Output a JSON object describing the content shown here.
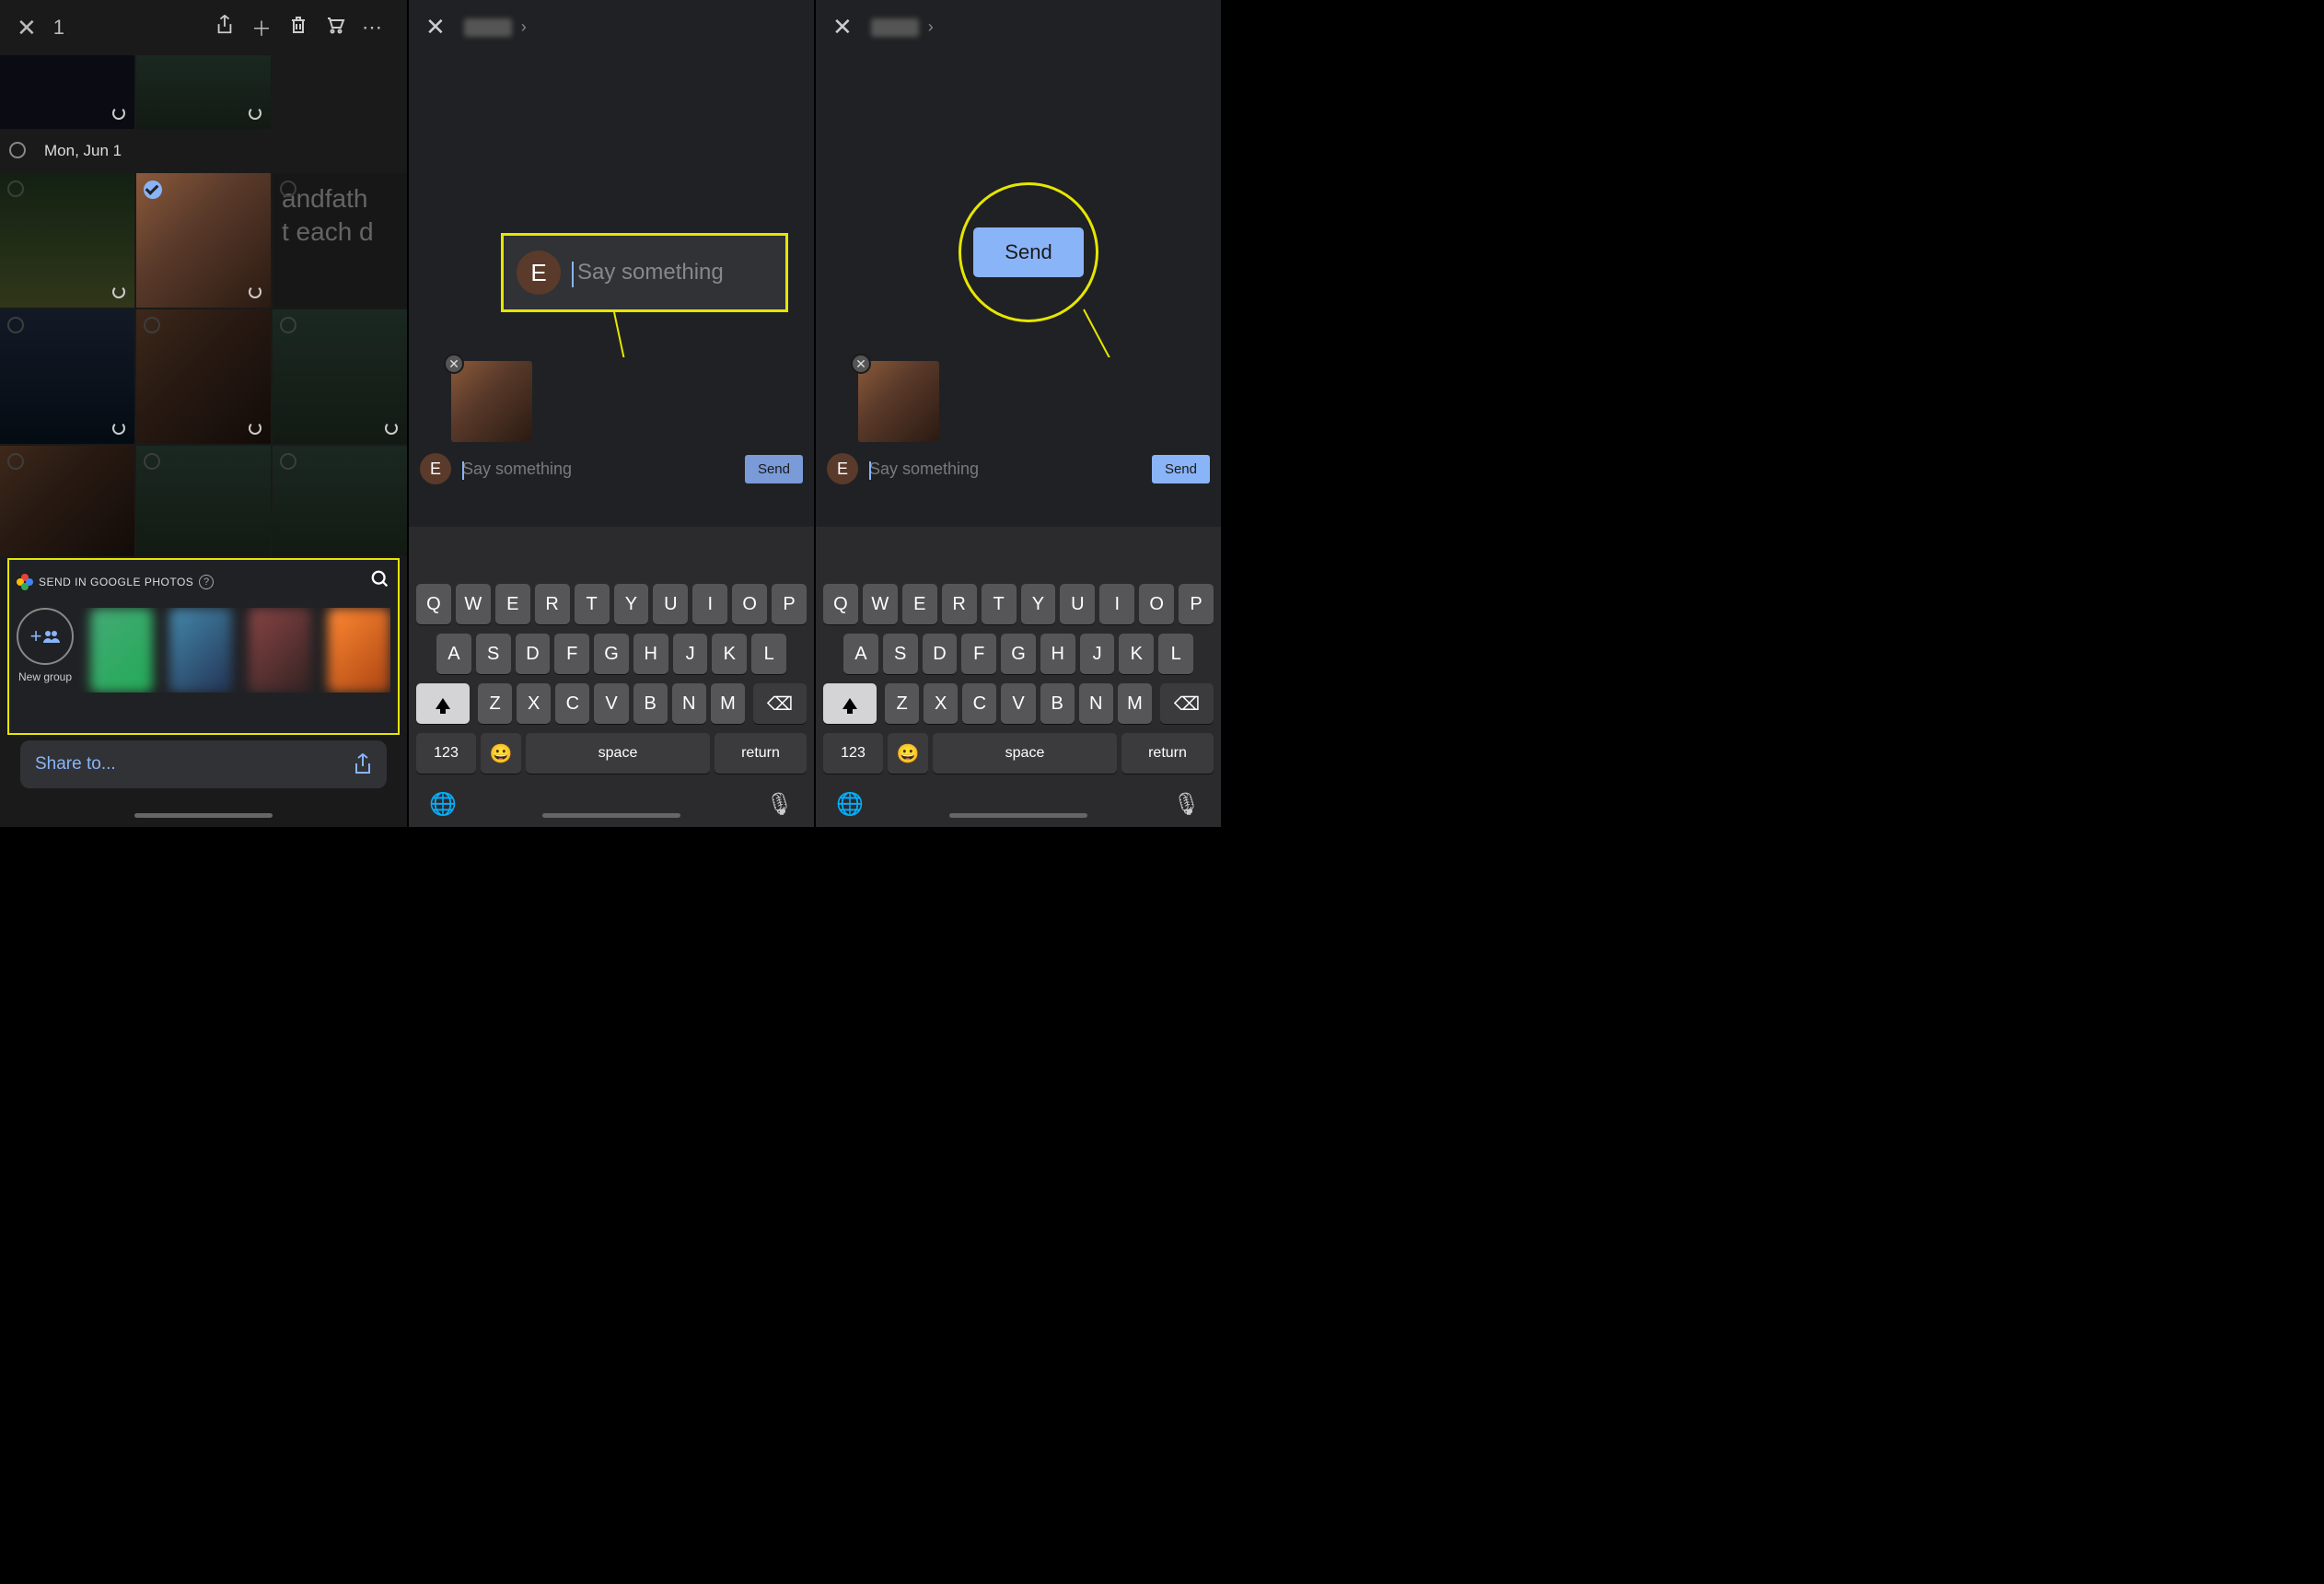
{
  "panel1": {
    "selected_count": "1",
    "section_date": "Mon, Jun 1",
    "snippet_line1": "andfath",
    "snippet_line2": "t each d",
    "sheet_title": "SEND IN GOOGLE PHOTOS",
    "new_group_label": "New group",
    "share_to_label": "Share to..."
  },
  "panel2": {
    "avatar_initial": "E",
    "placeholder": "Say something",
    "send_label": "Send",
    "callout_avatar": "E",
    "callout_placeholder": "Say something"
  },
  "panel3": {
    "avatar_initial": "E",
    "placeholder": "Say something",
    "send_label": "Send",
    "callout_send": "Send"
  },
  "keyboard": {
    "row1": [
      "Q",
      "W",
      "E",
      "R",
      "T",
      "Y",
      "U",
      "I",
      "O",
      "P"
    ],
    "row2": [
      "A",
      "S",
      "D",
      "F",
      "G",
      "H",
      "J",
      "K",
      "L"
    ],
    "row3": [
      "Z",
      "X",
      "C",
      "V",
      "B",
      "N",
      "M"
    ],
    "num": "123",
    "space": "space",
    "ret": "return"
  }
}
